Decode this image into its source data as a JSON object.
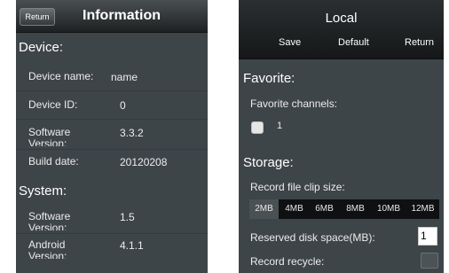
{
  "info_screen": {
    "return_label": "Return",
    "title": "Information",
    "device_section": "Device:",
    "device_rows": [
      {
        "label": "Device name:",
        "value": "name"
      },
      {
        "label": "Device ID:",
        "value": "0"
      },
      {
        "label": "Software Version:",
        "value": "3.3.2"
      },
      {
        "label": "Build date:",
        "value": "20120208"
      }
    ],
    "system_section": "System:",
    "system_rows": [
      {
        "label": "Software Version:",
        "value": "1.5"
      },
      {
        "label": "Android Version:",
        "value": "4.1.1"
      }
    ]
  },
  "local_screen": {
    "title": "Local",
    "save_label": "Save",
    "default_label": "Default",
    "return_label": "Return",
    "favorite_section": "Favorite:",
    "favorite_channels_label": "Favorite channels:",
    "channel_1_label": "1",
    "storage_section": "Storage:",
    "clip_size_label": "Record file clip size:",
    "clip_sizes": [
      "2MB",
      "4MB",
      "6MB",
      "8MB",
      "10MB",
      "12MB"
    ],
    "selected_clip_size": "2MB",
    "reserved_space_label": "Reserved disk space(MB):",
    "reserved_space_value": "1",
    "record_recycle_label": "Record recycle:"
  }
}
